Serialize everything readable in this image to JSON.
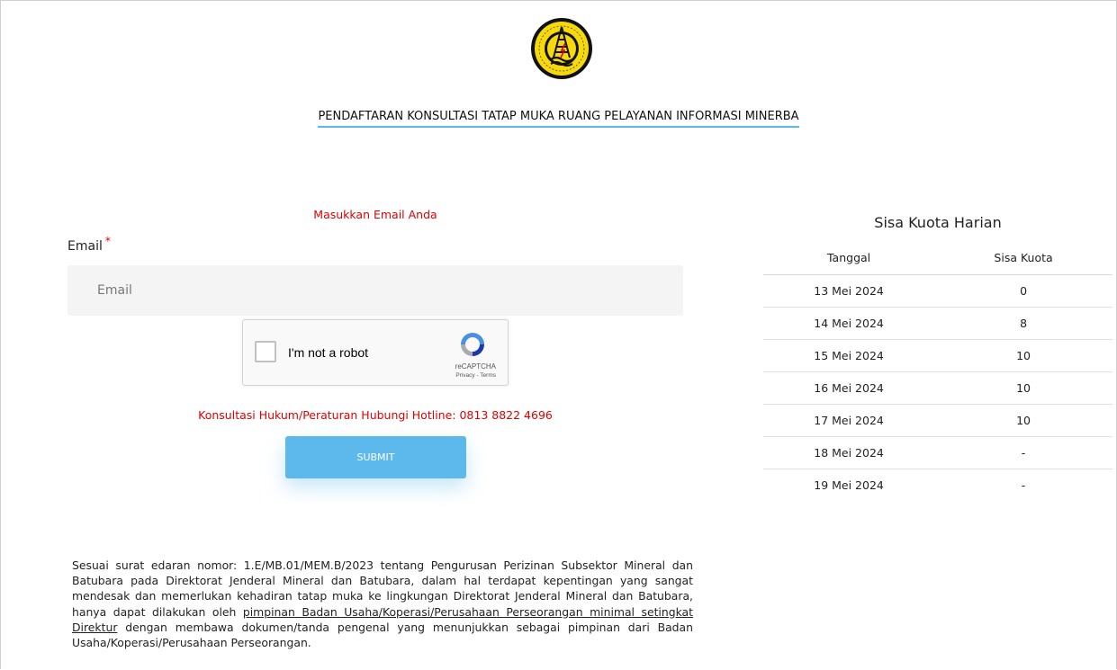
{
  "logo": {
    "icon": "esdm-emblem-icon",
    "alt": "Kementerian Energi dan Sumber Daya Mineral"
  },
  "page": {
    "title": "PENDAFTARAN KONSULTASI TATAP MUKA RUANG PELAYANAN INFORMASI MINERBA"
  },
  "form": {
    "prompt": "Masukkan Email Anda",
    "email_label": "Email",
    "required_mark": "*",
    "email_placeholder": "Email",
    "email_value": "",
    "captcha": {
      "text": "I'm not a robot",
      "brand": "reCAPTCHA",
      "links": "Privacy - Terms",
      "checked": false
    },
    "hotline": "Konsultasi Hukum/Peraturan Hubungi Hotline: 0813 8822 4696",
    "submit_label": "SUBMIT"
  },
  "notice": {
    "part1": "Sesuai surat edaran nomor: 1.E/MB.01/MEM.B/2023 tentang Pengurusan Perizinan Subsektor Mineral dan Batubara pada Direktorat Jenderal Mineral dan Batubara, dalam hal terdapat kepentingan yang sangat mendesak dan memerlukan kehadiran tatap muka ke lingkungan Direktorat Jenderal Mineral dan Batubara, hanya dapat dilakukan oleh ",
    "underlined": "pimpinan Badan Usaha/Koperasi/Perusahaan Perseorangan minimal setingkat Direktur",
    "part2": " dengan membawa dokumen/tanda pengenal yang menunjukkan sebagai pimpinan dari Badan Usaha/Koperasi/Perusahaan Perseorangan."
  },
  "quota": {
    "title": "Sisa Kuota Harian",
    "headers": [
      "Tanggal",
      "Sisa Kuota"
    ],
    "rows": [
      [
        "13 Mei 2024",
        "0"
      ],
      [
        "14 Mei 2024",
        "8"
      ],
      [
        "15 Mei 2024",
        "10"
      ],
      [
        "16 Mei 2024",
        "10"
      ],
      [
        "17 Mei 2024",
        "10"
      ],
      [
        "18 Mei 2024",
        "-"
      ],
      [
        "19 Mei 2024",
        "-"
      ]
    ]
  },
  "colors": {
    "accent": "#5db8ec",
    "alert_red": "#e00000",
    "input_bg": "#f4f4f4"
  }
}
